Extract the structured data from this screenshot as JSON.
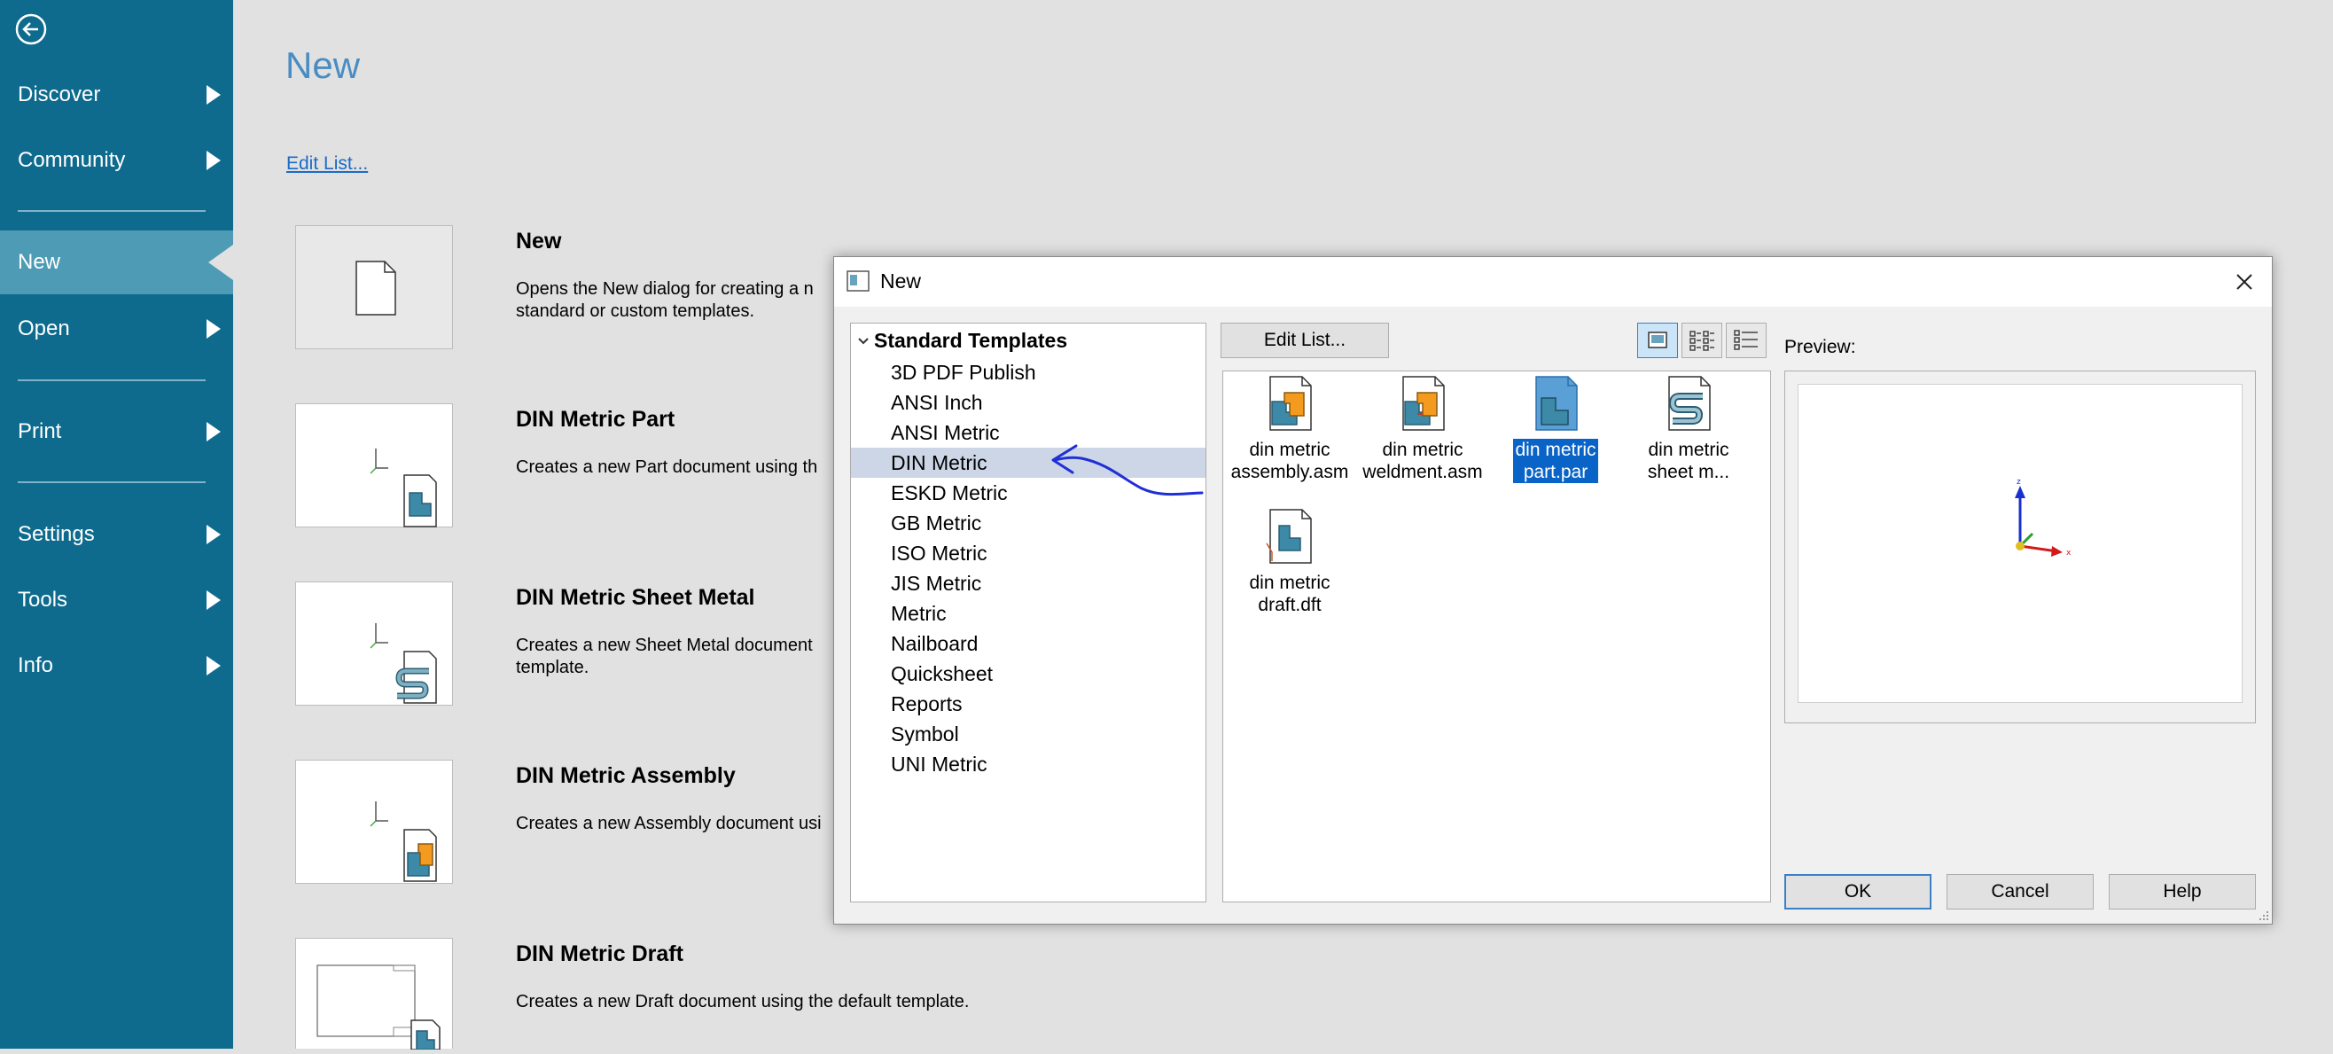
{
  "sidebar": {
    "items": [
      {
        "label": "Discover"
      },
      {
        "label": "Community"
      },
      {
        "label": "New"
      },
      {
        "label": "Open"
      },
      {
        "label": "Print"
      },
      {
        "label": "Settings"
      },
      {
        "label": "Tools"
      },
      {
        "label": "Info"
      }
    ]
  },
  "main": {
    "title": "New",
    "edit_list_link": "Edit List...",
    "templates": [
      {
        "title": "New",
        "description": "Opens the New dialog for creating a n\nstandard or custom templates."
      },
      {
        "title": "DIN Metric Part",
        "description": "Creates a new Part document using th"
      },
      {
        "title": "DIN Metric Sheet Metal",
        "description": "Creates a new Sheet Metal document\ntemplate."
      },
      {
        "title": "DIN Metric Assembly",
        "description": "Creates a new Assembly document usi"
      },
      {
        "title": "DIN Metric Draft",
        "description": "Creates a new Draft document using the default template."
      }
    ]
  },
  "dialog": {
    "title": "New",
    "tree": {
      "root": "Standard Templates",
      "items": [
        "3D PDF Publish",
        "ANSI Inch",
        "ANSI Metric",
        "DIN Metric",
        "ESKD Metric",
        "GB Metric",
        "ISO Metric",
        "JIS Metric",
        "Metric",
        "Nailboard",
        "Quicksheet",
        "Reports",
        "Symbol",
        "UNI Metric"
      ],
      "selected": "DIN Metric"
    },
    "edit_list_button": "Edit List...",
    "files": [
      {
        "label": "din metric\nassembly.asm",
        "icon": "assembly-file-icon"
      },
      {
        "label": "din metric\nweldment.asm",
        "icon": "weldment-file-icon"
      },
      {
        "label": "din metric\npart.par",
        "icon": "part-file-icon"
      },
      {
        "label": "din metric\nsheet m...",
        "icon": "sheet-metal-file-icon"
      },
      {
        "label": "din metric\ndraft.dft",
        "icon": "draft-file-icon"
      }
    ],
    "selected_file": "din metric\npart.par",
    "preview_label": "Preview:",
    "preview_axes": {
      "z": "z",
      "x": "x"
    },
    "buttons": {
      "ok": "OK",
      "cancel": "Cancel",
      "help": "Help"
    }
  },
  "colors": {
    "sidebar": "#0e6b8e",
    "sidebar_active": "#4e9bb5",
    "title": "#4a8dc3",
    "link": "#1a6bc6",
    "selection": "#0a64c8",
    "tree_selection": "#ccd6e6",
    "annotation": "#1f2fd6"
  }
}
